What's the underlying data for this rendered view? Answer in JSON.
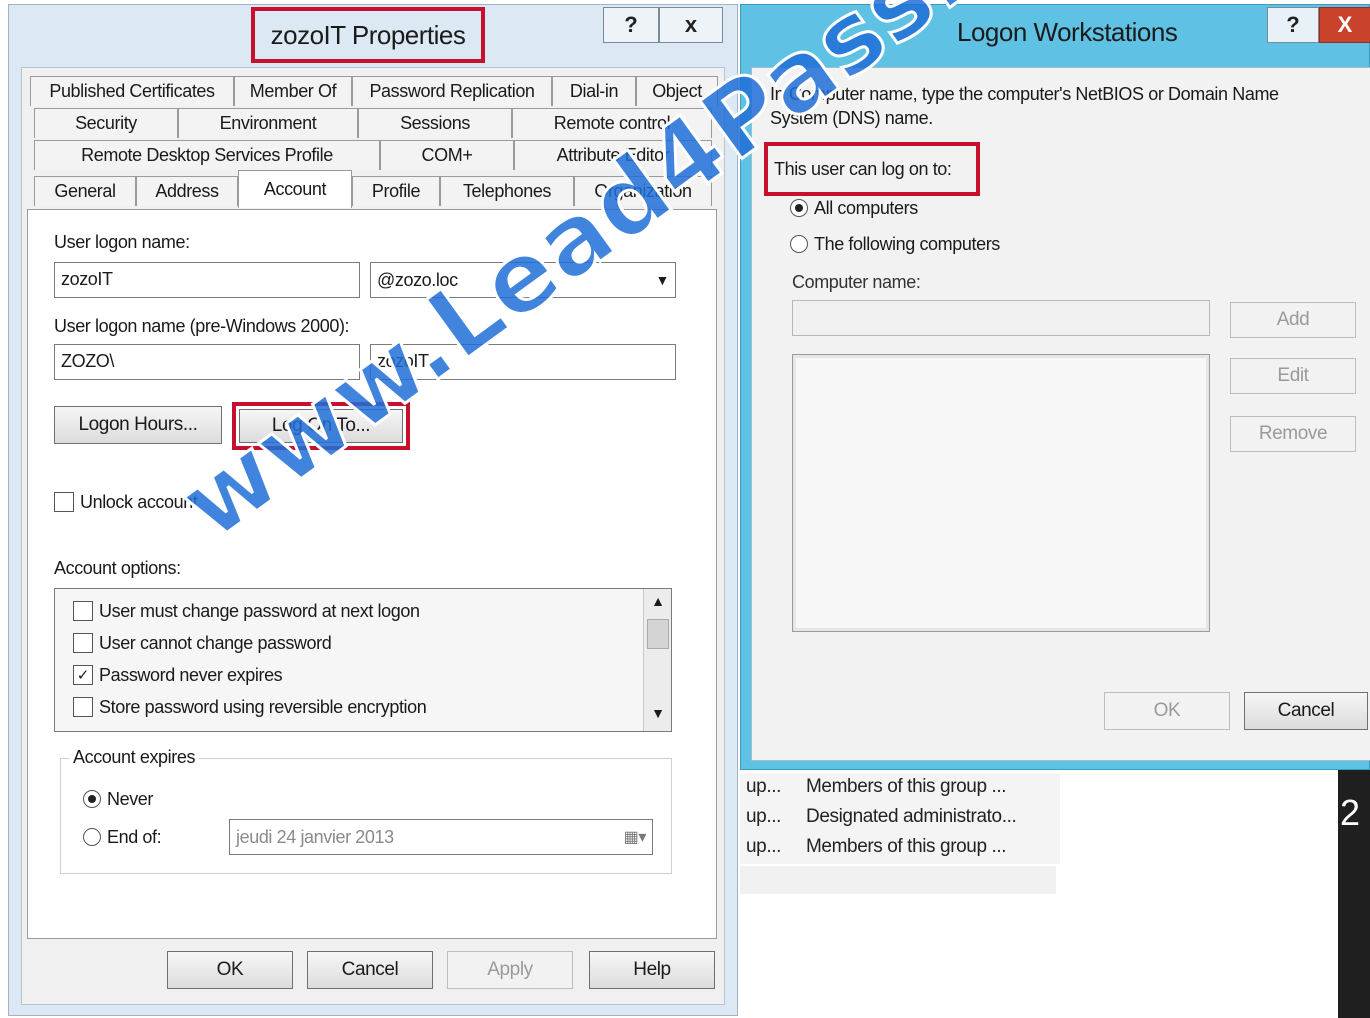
{
  "properties": {
    "title": "zozoIT Properties",
    "help_btn": "?",
    "close_btn": "x",
    "tabs_row1": [
      "Published Certificates",
      "Member Of",
      "Password Replication",
      "Dial-in",
      "Object"
    ],
    "tabs_row2": [
      "Security",
      "Environment",
      "Sessions",
      "Remote control"
    ],
    "tabs_row3": [
      "Remote Desktop Services Profile",
      "COM+",
      "Attribute Editor"
    ],
    "tabs_row4": [
      "General",
      "Address",
      "Account",
      "Profile",
      "Telephones",
      "Organization"
    ],
    "active_tab": "Account",
    "user_logon_name_label": "User logon name:",
    "user_logon_name_value": "zozoIT",
    "upn_suffix_value": "@zozo.loc",
    "pre2000_label": "User logon name (pre-Windows 2000):",
    "pre2000_domain_value": "ZOZO\\",
    "pre2000_user_value": "zozoIT",
    "logon_hours_btn": "Logon Hours...",
    "log_on_to_btn": "Log On To...",
    "unlock_label": "Unlock account",
    "account_options_label": "Account options:",
    "account_options": [
      {
        "label": "User must change password at next logon",
        "checked": false
      },
      {
        "label": "User cannot change password",
        "checked": false
      },
      {
        "label": "Password never expires",
        "checked": true
      },
      {
        "label": "Store password using reversible encryption",
        "checked": false
      }
    ],
    "account_expires_label": "Account expires",
    "never_label": "Never",
    "end_of_label": "End of:",
    "end_of_date_value": "jeudi 24 janvier 2013",
    "ok_btn": "OK",
    "cancel_btn": "Cancel",
    "apply_btn": "Apply",
    "help_bottom_btn": "Help"
  },
  "logon": {
    "title": "Logon Workstations",
    "help_btn": "?",
    "close_btn": "X",
    "instruction": "In Computer name, type the computer's NetBIOS or Domain Name System (DNS) name.",
    "can_log_on_label": "This user can log on to:",
    "all_computers_label": "All computers",
    "following_label": "The following computers",
    "computer_name_label": "Computer name:",
    "add_btn": "Add",
    "edit_btn": "Edit",
    "remove_btn": "Remove",
    "ok_btn": "OK",
    "cancel_btn": "Cancel"
  },
  "background_list": [
    {
      "col1": "up...",
      "col2": "Members of this group ..."
    },
    {
      "col1": "up...",
      "col2": "Designated administrato..."
    },
    {
      "col1": "up...",
      "col2": "Members of this group ..."
    }
  ],
  "background_edge_text": "2",
  "watermark": "www.Lead4Pass.com",
  "colors": {
    "highlight_red": "#c8102e",
    "logon_title_blue": "#5fc1e4",
    "watermark_blue": "#1e6ed7"
  }
}
